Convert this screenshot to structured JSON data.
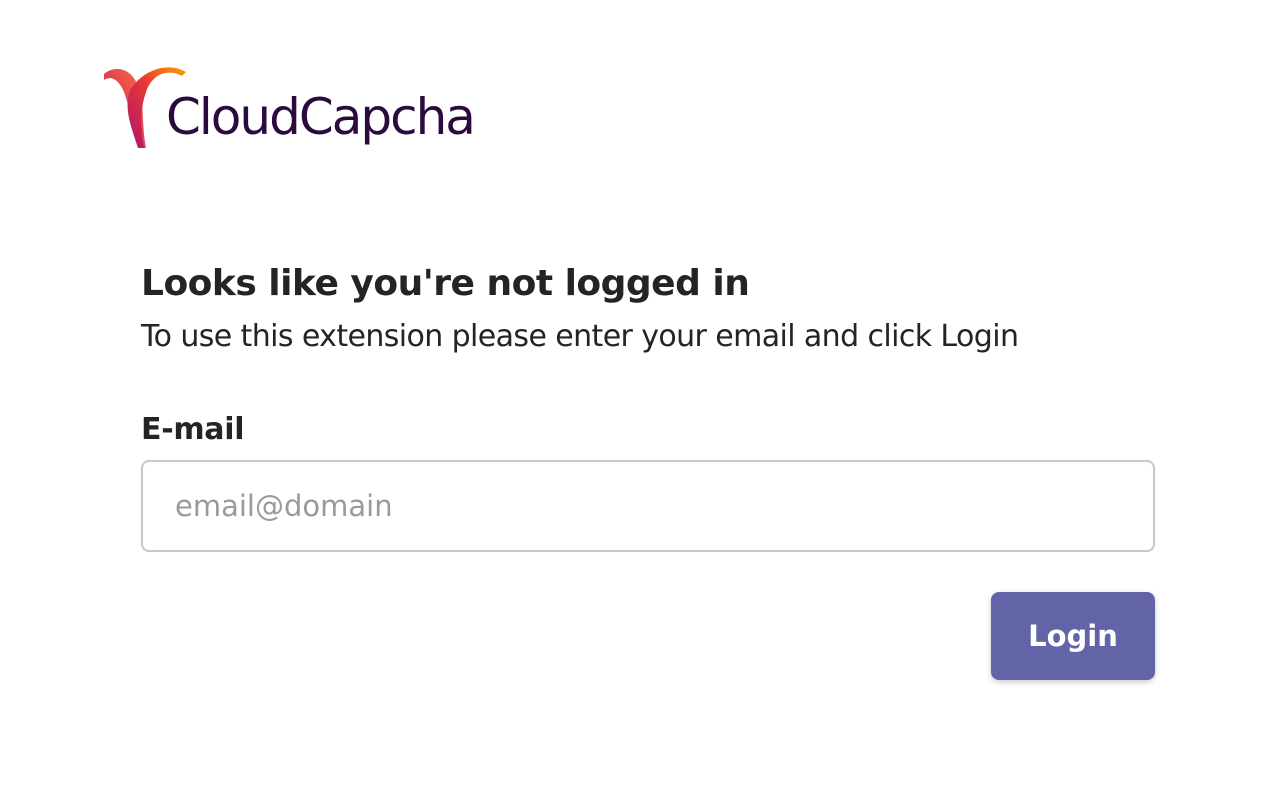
{
  "brand": {
    "name": "CloudCapcha",
    "logo_icon": "cloudcapcha-swoosh-icon",
    "text_color": "#2b0a3d",
    "gradient": [
      "#c2185b",
      "#e53935",
      "#ffa000"
    ]
  },
  "login": {
    "heading": "Looks like you're not logged in",
    "subtext": "To use this extension please enter your email and click Login",
    "email_label": "E-mail",
    "email_placeholder": "email@domain",
    "email_value": "",
    "button_label": "Login",
    "button_color": "#6264a7"
  }
}
